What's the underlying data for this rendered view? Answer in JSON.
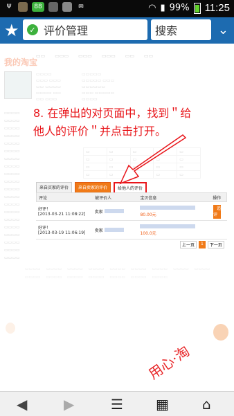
{
  "status_bar": {
    "battery_percent": "99%",
    "time": "11:25",
    "icons": [
      "usb-icon",
      "cat-icon",
      "battery-badge-icon",
      "gallery-icon",
      "image-icon",
      "mail-icon",
      "signal-icon",
      "wifi-icon"
    ],
    "battery_badge": "88"
  },
  "browser": {
    "url_text": "评价管理",
    "search_placeholder": "搜索",
    "colors": {
      "toolbar": "#1d6bb0",
      "shield": "#3db13d"
    }
  },
  "page": {
    "site_logo": "我的淘宝",
    "instruction_text": "8. 在弹出的对页面中，找到＂给他人的评价＂并点击打开。",
    "tabs": [
      {
        "label": "来自买家的评价"
      },
      {
        "label": "来自卖家的评价"
      },
      {
        "label": "给他人的评价"
      }
    ],
    "header": {
      "rating": "评论",
      "rated_user": "被评价人",
      "product": "宝贝信息",
      "operation": "操作"
    },
    "rows": [
      {
        "rating": "好评！",
        "date": "[2013-03-21 11:08:22]",
        "user": "卖家",
        "price": "80.00元",
        "button": "追评"
      },
      {
        "rating": "好评！",
        "date": "[2013-03-19 11:06:19]",
        "user": "卖家",
        "price": "100.0元"
      }
    ],
    "pager": {
      "prev": "上一页",
      "current": "1",
      "next": "下一页"
    },
    "watermark": "用心·淘"
  },
  "nav": {
    "icons": [
      "back-arrow-icon",
      "forward-arrow-icon",
      "menu-icon",
      "bookmarks-icon",
      "home-icon"
    ]
  }
}
